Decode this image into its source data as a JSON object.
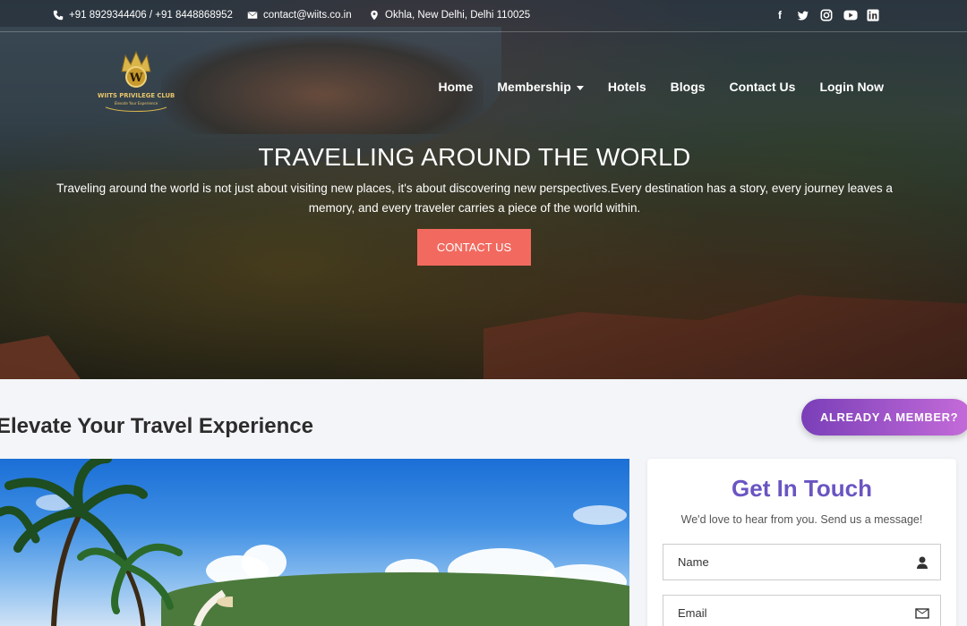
{
  "topbar": {
    "phone": "+91 8929344406 / +91 8448868952",
    "email": "contact@wiits.co.in",
    "address": "Okhla, New Delhi, Delhi 110025",
    "social_icons": [
      "facebook-icon",
      "twitter-icon",
      "instagram-icon",
      "youtube-icon",
      "linkedin-icon"
    ]
  },
  "logo": {
    "text": "WIITS PRIVILEGE CLUB",
    "tagline": "Elevate Your Experience"
  },
  "nav": {
    "items": [
      "Home",
      "Membership",
      "Hotels",
      "Blogs",
      "Contact Us",
      "Login Now"
    ]
  },
  "hero": {
    "title": "TRAVELLING AROUND THE WORLD",
    "subtitle": "Traveling around the world is not just about visiting new places, it's about discovering new perspectives.Every destination has a story, every journey leaves a memory, and every traveler carries a piece of the world within.",
    "cta_label": "CONTACT US"
  },
  "section": {
    "title": "Elevate Your Travel Experience",
    "member_button": "ALREADY A MEMBER?"
  },
  "contact_form": {
    "title": "Get In Touch",
    "subtitle": "We'd love to hear from you. Send us a message!",
    "name_placeholder": "Name",
    "email_placeholder": "Email"
  },
  "colors": {
    "cta": "#f26a5f",
    "accent_purple": "#6a55c2",
    "member_gradient_start": "#7a3fb8",
    "member_gradient_end": "#c56bd9"
  }
}
